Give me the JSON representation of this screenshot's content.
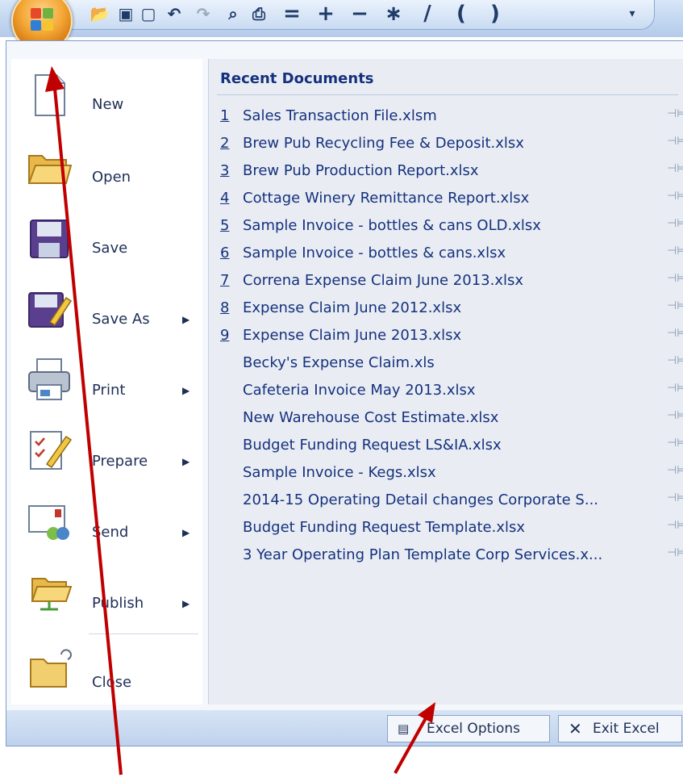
{
  "quick_access_toolbar": {
    "buttons": [
      "=",
      "+",
      "−",
      "∗",
      "/",
      "(",
      ")"
    ]
  },
  "office_button": {
    "icon": "office-logo-icon"
  },
  "left_menu": {
    "items": [
      {
        "label": "New",
        "icon": "new-document-icon",
        "has_submenu": false
      },
      {
        "label": "Open",
        "icon": "open-folder-icon",
        "has_submenu": false
      },
      {
        "label": "Save",
        "icon": "save-disk-icon",
        "has_submenu": false
      },
      {
        "label": "Save As",
        "icon": "save-as-icon",
        "has_submenu": true
      },
      {
        "label": "Print",
        "icon": "printer-icon",
        "has_submenu": true
      },
      {
        "label": "Prepare",
        "icon": "prepare-icon",
        "has_submenu": true
      },
      {
        "label": "Send",
        "icon": "send-icon",
        "has_submenu": true
      },
      {
        "label": "Publish",
        "icon": "publish-icon",
        "has_submenu": true
      },
      {
        "label": "Close",
        "icon": "close-folder-icon",
        "has_submenu": false
      }
    ],
    "submenu_arrow": "▶"
  },
  "recent_documents": {
    "title": "Recent Documents",
    "pin_glyph": "⊣⊨",
    "items": [
      {
        "num": "1",
        "name": "Sales Transaction File.xlsm"
      },
      {
        "num": "2",
        "name": "Brew Pub Recycling Fee & Deposit.xlsx"
      },
      {
        "num": "3",
        "name": "Brew Pub Production Report.xlsx"
      },
      {
        "num": "4",
        "name": "Cottage Winery Remittance Report.xlsx"
      },
      {
        "num": "5",
        "name": "Sample Invoice - bottles & cans OLD.xlsx"
      },
      {
        "num": "6",
        "name": "Sample Invoice - bottles & cans.xlsx"
      },
      {
        "num": "7",
        "name": "Correna Expense Claim June 2013.xlsx"
      },
      {
        "num": "8",
        "name": "Expense Claim June 2012.xlsx"
      },
      {
        "num": "9",
        "name": "Expense Claim June 2013.xlsx"
      },
      {
        "num": "",
        "name": "Becky's Expense Claim.xls"
      },
      {
        "num": "",
        "name": "Cafeteria Invoice May 2013.xlsx"
      },
      {
        "num": "",
        "name": "New Warehouse Cost Estimate.xlsx"
      },
      {
        "num": "",
        "name": "Budget Funding Request LS&IA.xlsx"
      },
      {
        "num": "",
        "name": "Sample Invoice - Kegs.xlsx"
      },
      {
        "num": "",
        "name": "2014-15 Operating Detail changes Corporate S..."
      },
      {
        "num": "",
        "name": "Budget Funding Request Template.xlsx"
      },
      {
        "num": "",
        "name": "3 Year Operating Plan Template Corp Services.x..."
      }
    ]
  },
  "bottom_buttons": {
    "excel_options": "Excel Options",
    "exit_excel": "Exit Excel"
  },
  "colors": {
    "annotation_arrow": "#c00000"
  }
}
